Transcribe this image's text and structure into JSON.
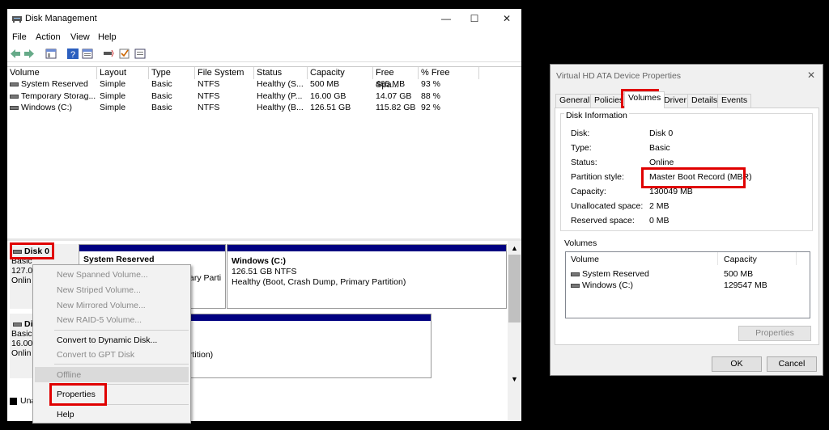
{
  "disk_mgmt": {
    "title": "Disk Management",
    "controls": {
      "minimize": "—",
      "maximize": "☐",
      "close": "✕"
    },
    "menu": [
      "File",
      "Action",
      "View",
      "Help"
    ],
    "columns": [
      "Volume",
      "Layout",
      "Type",
      "File System",
      "Status",
      "Capacity",
      "Free Spa...",
      "% Free"
    ],
    "rows": [
      [
        "System Reserved",
        "Simple",
        "Basic",
        "NTFS",
        "Healthy (S...",
        "500 MB",
        "465 MB",
        "93 %"
      ],
      [
        "Temporary Storag...",
        "Simple",
        "Basic",
        "NTFS",
        "Healthy (P...",
        "16.00 GB",
        "14.07 GB",
        "88 %"
      ],
      [
        "Windows (C:)",
        "Simple",
        "Basic",
        "NTFS",
        "Healthy (B...",
        "126.51 GB",
        "115.82 GB",
        "92 %"
      ]
    ],
    "disk0": {
      "name": "Disk 0",
      "type": "Basic",
      "size": "127.00",
      "status": "Onlin"
    },
    "disk1": {
      "name": "Di",
      "type": "Basic",
      "size": "16.00",
      "status": "Onlin"
    },
    "unalloc_label": "Una",
    "parts": {
      "sysres_title": "System Reserved",
      "sysres_tail": "ary Parti",
      "win_title": "Windows  (C:)",
      "win_size": "126.51 GB NTFS",
      "win_status": "Healthy (Boot, Crash Dump, Primary Partition)",
      "temp_tail": "rtition)"
    },
    "context_menu": {
      "items_disabled": [
        "New Spanned Volume...",
        "New Striped Volume...",
        "New Mirrored Volume...",
        "New RAID-5 Volume..."
      ],
      "convert_dynamic": "Convert to Dynamic Disk...",
      "convert_gpt": "Convert to GPT Disk",
      "offline": "Offline",
      "properties": "Properties",
      "help": "Help"
    }
  },
  "props_dialog": {
    "title": "Virtual HD ATA Device Properties",
    "close": "✕",
    "tabs": [
      "General",
      "Policies",
      "Volumes",
      "Driver",
      "Details",
      "Events"
    ],
    "active_tab": "Volumes",
    "disk_info_label": "Disk Information",
    "fields": [
      {
        "k": "Disk:",
        "v": "Disk 0"
      },
      {
        "k": "Type:",
        "v": "Basic"
      },
      {
        "k": "Status:",
        "v": "Online"
      },
      {
        "k": "Partition style:",
        "v": "Master Boot Record (MBR)"
      },
      {
        "k": "Capacity:",
        "v": "130049 MB"
      },
      {
        "k": "Unallocated space:",
        "v": "2 MB"
      },
      {
        "k": "Reserved space:",
        "v": "0 MB"
      }
    ],
    "volumes_label": "Volumes",
    "vol_headers": [
      "Volume",
      "Capacity"
    ],
    "volumes": [
      {
        "name": "System Reserved",
        "cap": "500 MB"
      },
      {
        "name": "Windows (C:)",
        "cap": "129547 MB"
      }
    ],
    "properties_btn": "Properties",
    "ok": "OK",
    "cancel": "Cancel"
  },
  "colors": {
    "highlight": "#e00000",
    "partition_bar": "#000080"
  }
}
